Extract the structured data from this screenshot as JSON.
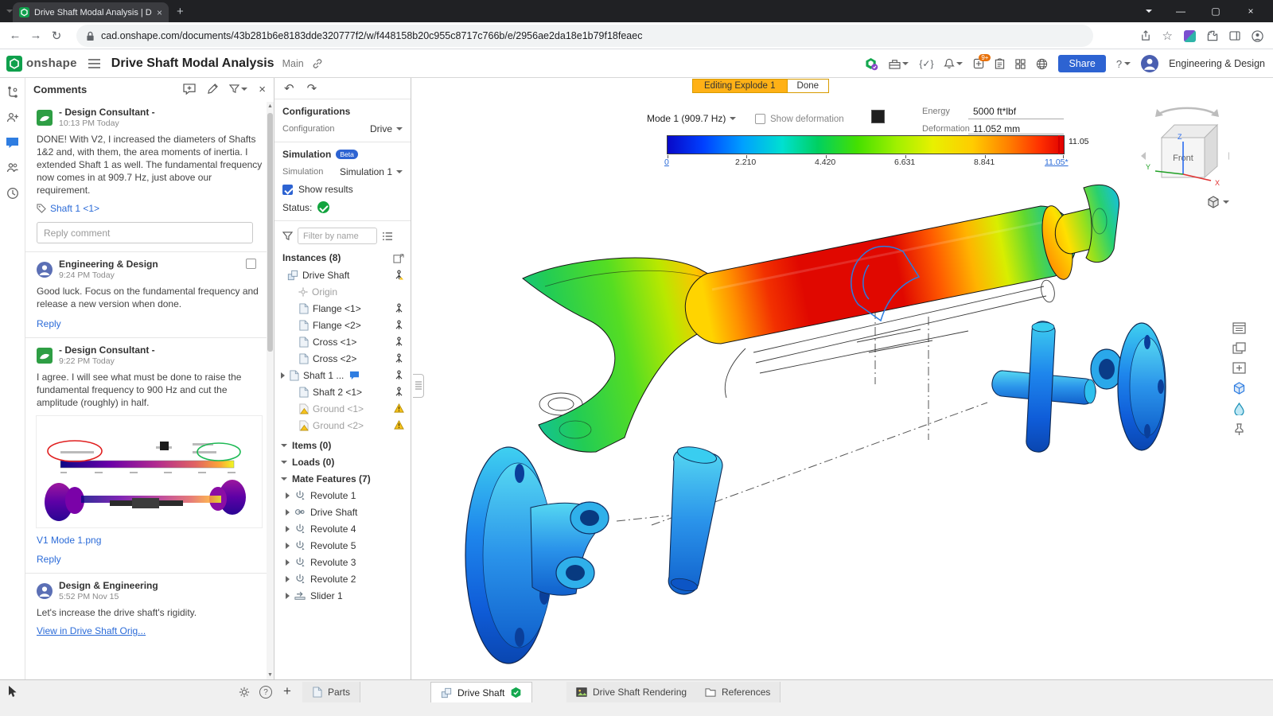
{
  "browser": {
    "tab_title": "Drive Shaft Modal Analysis | Driv",
    "url": "cad.onshape.com/documents/43b281b6e8183dde320777f2/w/f448158b20c955c8717c766b/e/2956ae2da18e1b79f18feaec"
  },
  "header": {
    "logo_text": "onshape",
    "title": "Drive Shaft Modal Analysis",
    "branch": "Main",
    "notification_badge": "9+",
    "share_label": "Share",
    "user_name": "Engineering & Design"
  },
  "misc": {
    "question_mark": "?"
  },
  "comments": {
    "title": "Comments",
    "reply_label": "Reply",
    "threads": [
      {
        "author": "- Design Consultant -",
        "time": "10:13 PM Today",
        "body": "DONE!  With V2, I increased the diameters of Shafts 1&2 and, with them, the area moments of inertia.  I extended Shaft 1 as well.  The fundamental frequency now comes in at 909.7 Hz, just above our requirement.",
        "tag": "Shaft 1 <1>",
        "reply_placeholder": "Reply comment"
      },
      {
        "author": "Engineering & Design",
        "time": "9:24 PM Today",
        "body": "Good luck.  Focus on the fundamental frequency and release a new version when done."
      },
      {
        "author": "- Design Consultant -",
        "time": "9:22 PM Today",
        "body": "I agree.  I will see what must be done to raise the fundamental frequency to 900 Hz and cut the amplitude (roughly) in half.",
        "attachment_name": "V1 Mode 1.png"
      },
      {
        "author": "Design & Engineering",
        "time": "5:52 PM Nov 15",
        "body": "Let's increase the drive shaft's rigidity.",
        "link": "View in Drive Shaft Orig..."
      }
    ]
  },
  "panel": {
    "configurations_title": "Configurations",
    "configuration_label": "Configuration",
    "configuration_value": "Drive",
    "simulation_title": "Simulation",
    "beta_badge": "Beta",
    "simulation_label": "Simulation",
    "simulation_value": "Simulation 1",
    "show_results_label": "Show results",
    "status_label": "Status:",
    "filter_placeholder": "Filter by name",
    "instances_title": "Instances (8)",
    "items_title": "Items (0)",
    "loads_title": "Loads (0)",
    "mates_title": "Mate Features (7)",
    "instances": [
      {
        "label": "Drive Shaft"
      },
      {
        "label": "Origin"
      },
      {
        "label": "Flange <1>"
      },
      {
        "label": "Flange <2>"
      },
      {
        "label": "Cross <1>"
      },
      {
        "label": "Cross <2>"
      },
      {
        "label": "Shaft 1 ..."
      },
      {
        "label": "Shaft 2 <1>"
      },
      {
        "label": "Ground <1>"
      },
      {
        "label": "Ground <2>"
      }
    ],
    "mates": [
      {
        "label": "Revolute 1"
      },
      {
        "label": "Drive Shaft"
      },
      {
        "label": "Revolute 4"
      },
      {
        "label": "Revolute 5"
      },
      {
        "label": "Revolute 3"
      },
      {
        "label": "Revolute 2"
      },
      {
        "label": "Slider 1"
      }
    ]
  },
  "viewport": {
    "banner_label": "Editing Explode 1",
    "done_label": "Done",
    "mode_value": "Mode 1 (909.7 Hz)",
    "show_deformation_label": "Show deformation",
    "energy_label": "Energy",
    "energy_value": "5000 ft*lbf",
    "deformation_label": "Deformation",
    "deformation_value": "11.052 mm",
    "scale_max_label": "11.05",
    "scale_ticks": [
      "0",
      "2.210",
      "4.420",
      "6.631",
      "8.841",
      "11.05*"
    ],
    "view_cube_face": "Front",
    "axes": {
      "x": "X",
      "y": "Y",
      "z": "Z"
    }
  },
  "tabs": {
    "items": [
      {
        "label": "Parts"
      },
      {
        "label": "Drive Shaft"
      },
      {
        "label": "Drive Shaft Rendering"
      },
      {
        "label": "References"
      }
    ]
  }
}
